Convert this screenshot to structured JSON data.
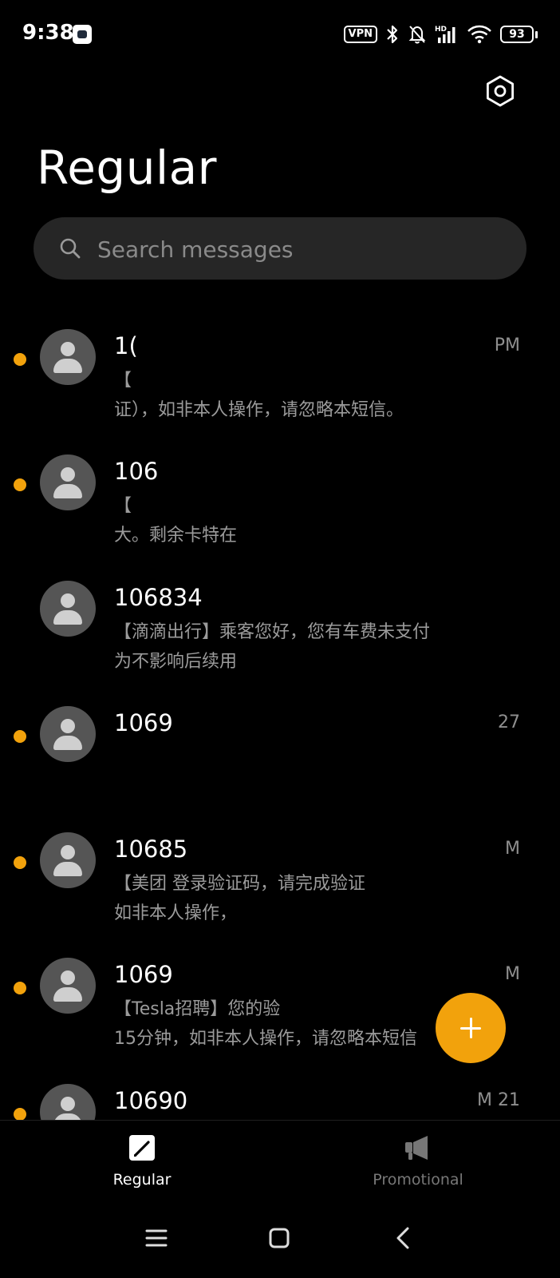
{
  "status_bar": {
    "time": "9:38",
    "vpn_label": "VPN",
    "network_label": "HD",
    "battery": "93"
  },
  "header": {
    "title": "Regular",
    "settings_icon": "gear-icon"
  },
  "search": {
    "placeholder": "Search messages",
    "value": ""
  },
  "messages": [
    {
      "sender": "1(",
      "time": "PM",
      "preview": "【 \n证），如非本人操作，请忽略本短信。",
      "unread": true
    },
    {
      "sender": "106",
      "time": "",
      "preview": "【\n大。剩余卡特在",
      "unread": true
    },
    {
      "sender": "106834",
      "time": "",
      "preview": "【滴滴出行】乘客您好，您有车费未支付\n为不影响后续用",
      "unread": false
    },
    {
      "sender": "1069",
      "time": "27",
      "preview": "",
      "unread": true
    },
    {
      "sender": "10685",
      "time": "M",
      "preview": "【美团 登录验证码，请完成验证\n如非本人操作，",
      "unread": true
    },
    {
      "sender": "1069",
      "time": "M",
      "preview": "【Tesla招聘】您的验\n15分钟，如非本人操作，请忽略本短信",
      "unread": true
    },
    {
      "sender": "10690",
      "time": "M 21",
      "preview": "",
      "unread": true
    }
  ],
  "fab": {
    "icon": "plus-icon"
  },
  "bottom_nav": {
    "tabs": [
      {
        "label": "Regular",
        "icon": "compose-icon",
        "active": true
      },
      {
        "label": "Promotional",
        "icon": "megaphone-icon",
        "active": false
      }
    ]
  },
  "colors": {
    "accent": "#f2a20c",
    "background": "#000000",
    "search_bg": "#262626",
    "avatar_bg": "#555555"
  }
}
